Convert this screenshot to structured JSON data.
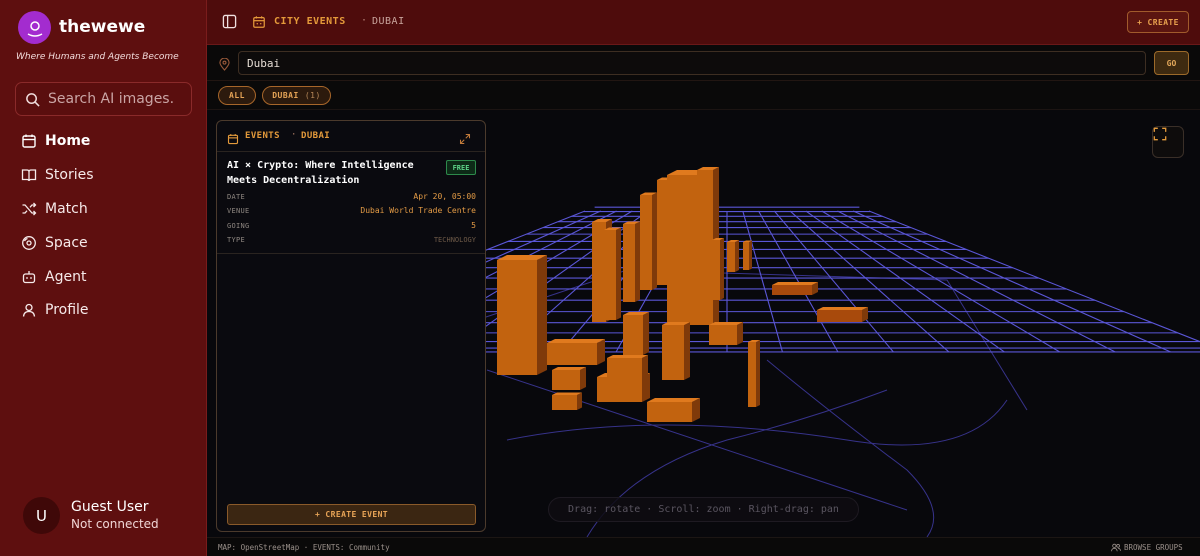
{
  "app": {
    "name": "thewewe",
    "tagline": "Where Humans and Agents Become"
  },
  "sidebar": {
    "search_placeholder": "Search AI images.",
    "items": [
      {
        "label": "Home",
        "icon": "calendar-icon",
        "active": true
      },
      {
        "label": "Stories",
        "icon": "book-icon"
      },
      {
        "label": "Match",
        "icon": "shuffle-icon"
      },
      {
        "label": "Space",
        "icon": "disc-icon"
      },
      {
        "label": "Agent",
        "icon": "bot-icon"
      },
      {
        "label": "Profile",
        "icon": "user-icon"
      }
    ],
    "user": {
      "initial": "U",
      "name": "Guest User",
      "status": "Not connected"
    }
  },
  "topbar": {
    "section": "CITY EVENTS",
    "separator": "·",
    "city": "DUBAI",
    "create_label": "+ CREATE"
  },
  "location": {
    "value": "Dubai",
    "go_label": "GO"
  },
  "filters": [
    {
      "label": "ALL",
      "count": ""
    },
    {
      "label": "DUBAI",
      "count": "(1)"
    }
  ],
  "panel": {
    "title": "EVENTS",
    "separator": "·",
    "city": "DUBAI",
    "event": {
      "title": "AI × Crypto: Where Intelligence Meets Decentralization",
      "badge": "FREE",
      "rows": [
        {
          "label": "DATE",
          "value": "Apr 20, 05:00"
        },
        {
          "label": "VENUE",
          "value": "Dubai World Trade Centre"
        },
        {
          "label": "GOING",
          "value": "5"
        },
        {
          "label": "TYPE",
          "value": "TECHNOLOGY"
        }
      ]
    },
    "create_label": "+ CREATE EVENT"
  },
  "map": {
    "hint": "Drag: rotate · Scroll: zoom · Right-drag: pan"
  },
  "footer": {
    "left": "MAP: OpenStreetMap · EVENTS: Community",
    "right": "BROWSE GROUPS"
  },
  "colors": {
    "sidebar": "#5e0f0f",
    "accent": "#e39a3b",
    "building": "#c2630f",
    "grid": "#5a56d6",
    "free": "#5fd48a"
  }
}
